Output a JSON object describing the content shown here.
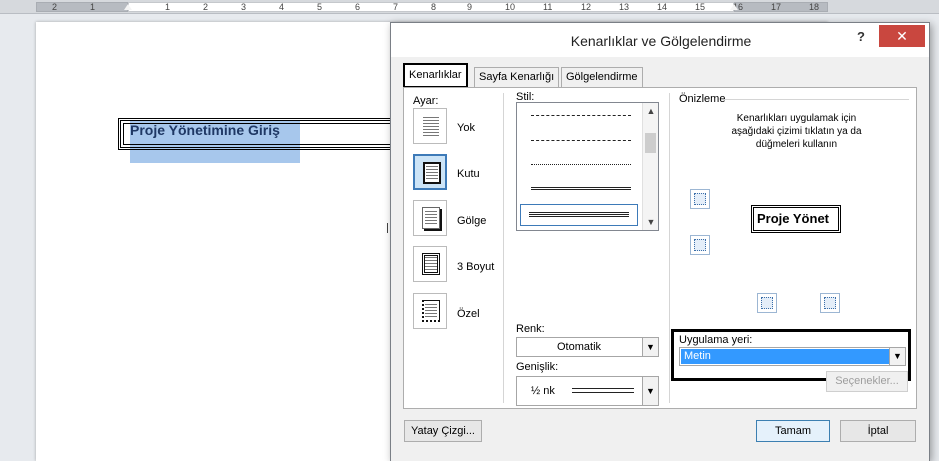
{
  "ruler": {
    "numbers": [
      "2",
      "1",
      "1",
      "2",
      "3",
      "4",
      "5",
      "6",
      "7",
      "8",
      "9",
      "10",
      "11",
      "12",
      "13",
      "14",
      "15",
      "16",
      "17",
      "18"
    ]
  },
  "document": {
    "heading": "Proje Yönetimine Giriş"
  },
  "dialog": {
    "title": "Kenarlıklar ve Gölgelendirme",
    "help": "?",
    "close": "✕",
    "tabs": [
      "Kenarlıklar",
      "Sayfa Kenarlığı",
      "Gölgelendirme"
    ],
    "setting": {
      "label": "Ayar:",
      "items": [
        "Yok",
        "Kutu",
        "Gölge",
        "3 Boyut",
        "Özel"
      ]
    },
    "style": {
      "label": "Stil:"
    },
    "color": {
      "label": "Renk:",
      "value": "Otomatik"
    },
    "width": {
      "label": "Genişlik:",
      "value": "½ nk"
    },
    "preview": {
      "label": "Önizleme",
      "hint": "Kenarlıkları uygulamak için aşağıdaki çizimi tıklatın ya da düğmeleri kullanın",
      "sample": "Proje Yönet"
    },
    "apply_to": {
      "label": "Uygulama yeri:",
      "value": "Metin"
    },
    "buttons": {
      "options": "Seçenekler...",
      "horizontal_line": "Yatay Çizgi...",
      "ok": "Tamam",
      "cancel": "İptal"
    }
  },
  "colors": {
    "selection": "#a7c7ec",
    "close_button": "#c9473f",
    "combo_selected": "#3399ff"
  }
}
